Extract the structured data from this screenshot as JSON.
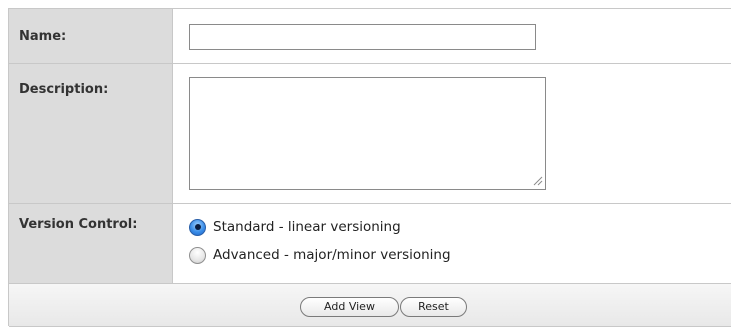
{
  "form": {
    "name": {
      "label": "Name:",
      "value": ""
    },
    "description": {
      "label": "Description:",
      "value": ""
    },
    "version_control": {
      "label": "Version Control:",
      "options": [
        {
          "label": "Standard - linear versioning",
          "selected": true
        },
        {
          "label": "Advanced - major/minor versioning",
          "selected": false
        }
      ]
    }
  },
  "actions": {
    "add_label": "Add View",
    "reset_label": "Reset"
  },
  "colors": {
    "label_bg": "#dcdcdc",
    "border": "#c8c8c8",
    "radio_selected": "#3b8ee8"
  },
  "icons": {
    "resize": "resize-grip-icon",
    "radio_on": "radio-selected-icon",
    "radio_off": "radio-unselected-icon"
  }
}
